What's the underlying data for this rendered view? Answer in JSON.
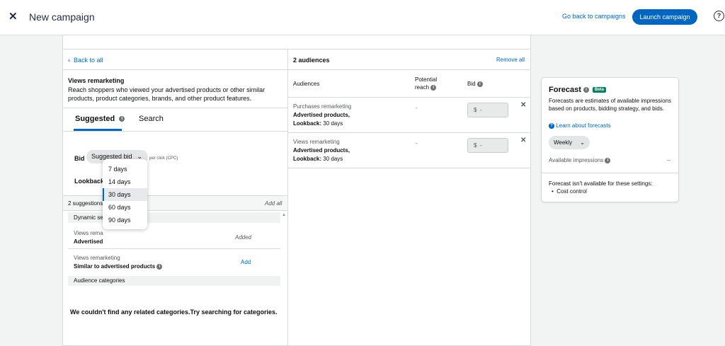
{
  "header": {
    "title": "New campaign",
    "back_link": "Go back to campaigns",
    "launch_button": "Launch campaign"
  },
  "left": {
    "back_link": "Back to all",
    "section_title": "Views remarketing",
    "section_desc": "Reach shoppers who viewed your advertised products or other similar products, product categories, brands, and other product features.",
    "tabs": [
      "Suggested",
      "Search"
    ],
    "bid_label": "Bid",
    "bid_select": "Suggested bid",
    "per_click": "per click (CPC)",
    "lookback_label": "Lookback",
    "lookback_options": [
      "7 days",
      "14 days",
      "30 days",
      "60 days",
      "90 days"
    ],
    "lookback_selected": "30 days",
    "suggestions_count": "2 suggestions",
    "add_all": "Add all",
    "group_dynamic": "Dynamic se",
    "rows": [
      {
        "sub": "Views rema",
        "main": "Advertised",
        "action": "Added"
      },
      {
        "sub": "Views remarketing",
        "main": "Similar to advertised products",
        "action": "Add"
      }
    ],
    "group_categories": "Audience categories",
    "empty_categories": "We couldn't find any related categories.Try searching for categories."
  },
  "right": {
    "audiences_count": "2 audiences",
    "remove_all": "Remove all",
    "columns": {
      "audiences": "Audiences",
      "potential_reach": "Potential reach",
      "bid": "Bid"
    },
    "audiences": [
      {
        "sub": "Purchases remarketing",
        "main": "Advertised products,",
        "lookback_label": "Lookback:",
        "lookback_value": " 30 days",
        "reach": "-",
        "currency": "$",
        "bid": "-"
      },
      {
        "sub": "Views remarketing",
        "main": "Advertised products,",
        "lookback_label": "Lookback:",
        "lookback_value": " 30 days",
        "reach": "-",
        "currency": "$",
        "bid": "-"
      }
    ]
  },
  "forecast": {
    "title": "Forecast",
    "badge": "Beta",
    "desc": "Forecasts are estimates of available impressions based on products, bidding strategy, and bids.",
    "learn_link": "Learn about forecasts",
    "period": "Weekly",
    "available_label": "Available impressions",
    "available_value": "--",
    "not_available": "Forecast isn't available for these settings:",
    "reasons": [
      "Cost control"
    ]
  },
  "colors": {
    "accent": "#0066c0",
    "beta": "#067d62"
  }
}
